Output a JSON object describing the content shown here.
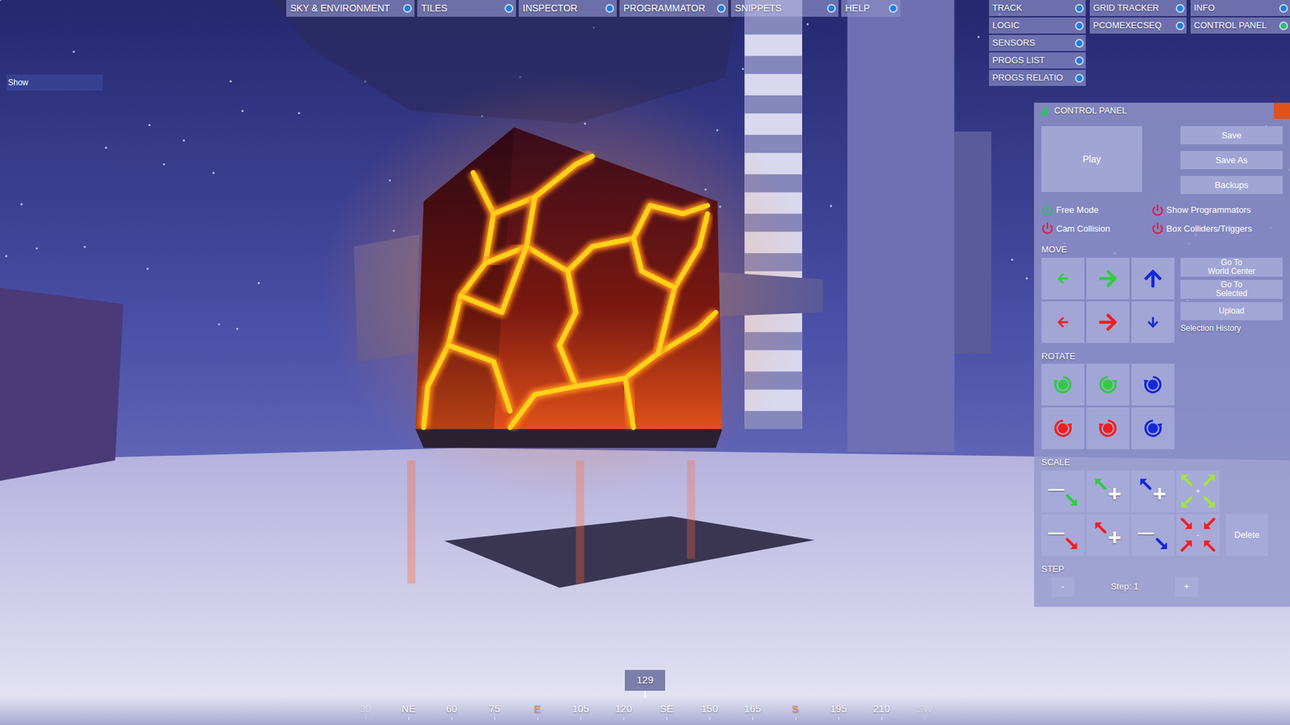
{
  "top_menu": [
    {
      "label": "SKY & ENVIRONMENT",
      "selected": false
    },
    {
      "label": "TILES",
      "selected": false
    },
    {
      "label": "INSPECTOR",
      "selected": false
    },
    {
      "label": "PROGRAMMATOR",
      "selected": false
    },
    {
      "label": "SNIPPETS",
      "selected": false
    },
    {
      "label": "HELP",
      "selected": false
    }
  ],
  "side_menu": {
    "columns": [
      [
        {
          "label": "TRACK",
          "selected": false
        },
        {
          "label": "LOGIC",
          "selected": false
        },
        {
          "label": "SENSORS",
          "selected": false
        },
        {
          "label": "PROGS LIST",
          "selected": false
        },
        {
          "label": "PROGS RELATIO",
          "selected": false
        }
      ],
      [
        {
          "label": "GRID TRACKER",
          "selected": false
        },
        {
          "label": "PCOMEXECSEQ",
          "selected": false
        }
      ],
      [
        {
          "label": "INFO",
          "selected": false
        },
        {
          "label": "CONTROL PANEL",
          "selected": true
        }
      ]
    ]
  },
  "show_button": "Show",
  "control_panel": {
    "title": "CONTROL PANEL",
    "play": "Play",
    "file_buttons": [
      "Save",
      "Save As",
      "Backups"
    ],
    "toggles": [
      {
        "label": "Free Mode",
        "on": true
      },
      {
        "label": "Show Programmators",
        "on": false
      },
      {
        "label": "Cam Collision",
        "on": false
      },
      {
        "label": "Box Colliders/Triggers",
        "on": false
      }
    ],
    "move": {
      "label": "MOVE",
      "buttons": [
        {
          "kind": "left",
          "color": "#2ecc40"
        },
        {
          "kind": "right",
          "color": "#2ecc40"
        },
        {
          "kind": "up",
          "color": "#1428d8"
        },
        {
          "kind": "left",
          "color": "#ee2020"
        },
        {
          "kind": "right",
          "color": "#ee2020"
        },
        {
          "kind": "down",
          "color": "#1428d8"
        }
      ]
    },
    "nav_buttons": [
      {
        "lines": [
          "Go To",
          "World Center"
        ]
      },
      {
        "lines": [
          "Go To",
          "Selected"
        ]
      },
      {
        "lines": [
          "Upload"
        ]
      }
    ],
    "selection_history": "Selection History",
    "rotate": {
      "label": "ROTATE",
      "buttons": [
        {
          "kind": "ccw",
          "color": "#2ecc40"
        },
        {
          "kind": "cw",
          "color": "#2ecc40"
        },
        {
          "kind": "ccw",
          "color": "#1428d8"
        },
        {
          "kind": "cw",
          "color": "#ee2020"
        },
        {
          "kind": "ccw",
          "color": "#ee2020"
        },
        {
          "kind": "cw",
          "color": "#1428d8"
        }
      ]
    },
    "scale": {
      "label": "SCALE",
      "buttons": [
        {
          "kind": "minus",
          "symbol": "—",
          "color": "#2ecc40"
        },
        {
          "kind": "plus",
          "symbol": "+",
          "color": "#2ecc40"
        },
        {
          "kind": "plus",
          "symbol": "+",
          "color": "#1428d8"
        },
        {
          "kind": "grow",
          "symbol": "+",
          "color": "#a3e635"
        },
        {
          "kind": "minus",
          "symbol": "—",
          "color": "#ee2020"
        },
        {
          "kind": "plus",
          "symbol": "+",
          "color": "#ee2020"
        },
        {
          "kind": "minus",
          "symbol": "—",
          "color": "#1428d8"
        },
        {
          "kind": "shrink",
          "symbol": "-",
          "color": "#ee2020"
        }
      ]
    },
    "delete": "Delete",
    "step": {
      "label": "STEP",
      "minus": "-",
      "value": "Step: 1",
      "plus": "+"
    }
  },
  "compass": {
    "heading": "129",
    "ticks": [
      {
        "label": "30",
        "color": "#ffffff",
        "faded": true
      },
      {
        "label": "NE",
        "color": "#ffffff",
        "faded": false
      },
      {
        "label": "60",
        "color": "#ffffff",
        "faded": false
      },
      {
        "label": "75",
        "color": "#ffffff",
        "faded": false
      },
      {
        "label": "E",
        "color": "#f0922e",
        "faded": false
      },
      {
        "label": "105",
        "color": "#ffffff",
        "faded": false
      },
      {
        "label": "120",
        "color": "#ffffff",
        "faded": false
      },
      {
        "label": "SE",
        "color": "#ffffff",
        "faded": false
      },
      {
        "label": "150",
        "color": "#ffffff",
        "faded": false
      },
      {
        "label": "165",
        "color": "#ffffff",
        "faded": false
      },
      {
        "label": "S",
        "color": "#f0922e",
        "faded": false
      },
      {
        "label": "195",
        "color": "#ffffff",
        "faded": false
      },
      {
        "label": "210",
        "color": "#ffffff",
        "faded": false
      },
      {
        "label": "SW",
        "color": "#ffffff",
        "faded": true
      }
    ]
  }
}
